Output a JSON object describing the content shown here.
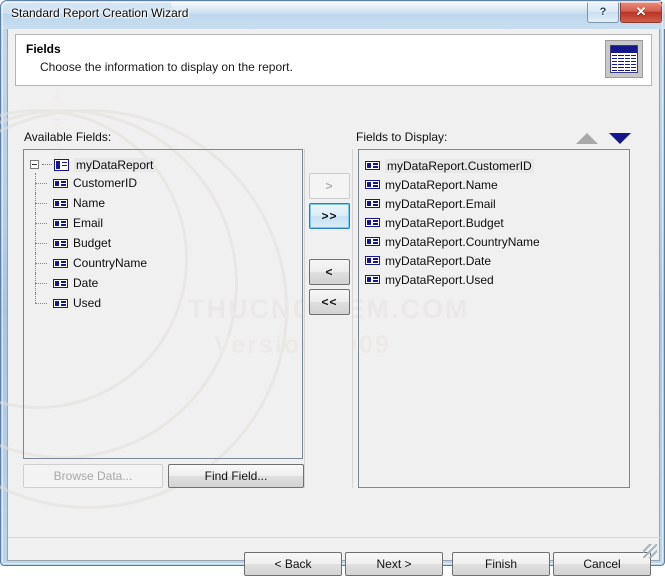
{
  "window": {
    "title": "Standard Report Creation Wizard",
    "help_label": "?",
    "close_label": "✕"
  },
  "header": {
    "title": "Fields",
    "subtitle": "Choose the information to display on the report.",
    "icon": "report-sheet-icon"
  },
  "watermark": {
    "line1": "THUCNGHIEM.COM",
    "line2": "Version 2009",
    "vertical": "THUCNGHIEM.COM"
  },
  "available": {
    "label": "Available Fields:",
    "root": {
      "label": "myDataReport",
      "icon": "table-icon",
      "expanded": true,
      "selected": true
    },
    "children": [
      {
        "label": "CustomerID",
        "icon": "field-icon"
      },
      {
        "label": "Name",
        "icon": "field-icon"
      },
      {
        "label": "Email",
        "icon": "field-icon"
      },
      {
        "label": "Budget",
        "icon": "field-icon"
      },
      {
        "label": "CountryName",
        "icon": "field-icon"
      },
      {
        "label": "Date",
        "icon": "field-icon"
      },
      {
        "label": "Used",
        "icon": "field-icon"
      }
    ]
  },
  "display": {
    "label": "Fields to Display:",
    "sort_up": {
      "name": "move-up-icon",
      "enabled": false
    },
    "sort_down": {
      "name": "move-down-icon",
      "enabled": true
    },
    "items": [
      {
        "label": "myDataReport.CustomerID",
        "icon": "field-icon",
        "selected": true
      },
      {
        "label": "myDataReport.Name",
        "icon": "field-icon",
        "selected": false
      },
      {
        "label": "myDataReport.Email",
        "icon": "field-icon",
        "selected": false
      },
      {
        "label": "myDataReport.Budget",
        "icon": "field-icon",
        "selected": false
      },
      {
        "label": "myDataReport.CountryName",
        "icon": "field-icon",
        "selected": false
      },
      {
        "label": "myDataReport.Date",
        "icon": "field-icon",
        "selected": false
      },
      {
        "label": "myDataReport.Used",
        "icon": "field-icon",
        "selected": false
      }
    ]
  },
  "transfer": {
    "add": {
      "label": ">",
      "state": "disabled"
    },
    "add_all": {
      "label": ">>",
      "state": "focused"
    },
    "remove": {
      "label": "<",
      "state": "normal"
    },
    "remove_all": {
      "label": "<<",
      "state": "normal"
    }
  },
  "tools": {
    "browse_data": {
      "label": "Browse Data...",
      "state": "disabled"
    },
    "find_field": {
      "label": "Find Field...",
      "state": "normal"
    }
  },
  "footer": {
    "back": {
      "label": "< Back",
      "state": "normal"
    },
    "next": {
      "label": "Next >",
      "state": "normal"
    },
    "finish": {
      "label": "Finish",
      "state": "normal"
    },
    "cancel": {
      "label": "Cancel",
      "state": "normal"
    }
  },
  "colors": {
    "accent_blue": "#16168e",
    "close_red": "#b93323",
    "focus_blue": "#2a7fbd",
    "selection_grey": "#e8e8e8"
  }
}
